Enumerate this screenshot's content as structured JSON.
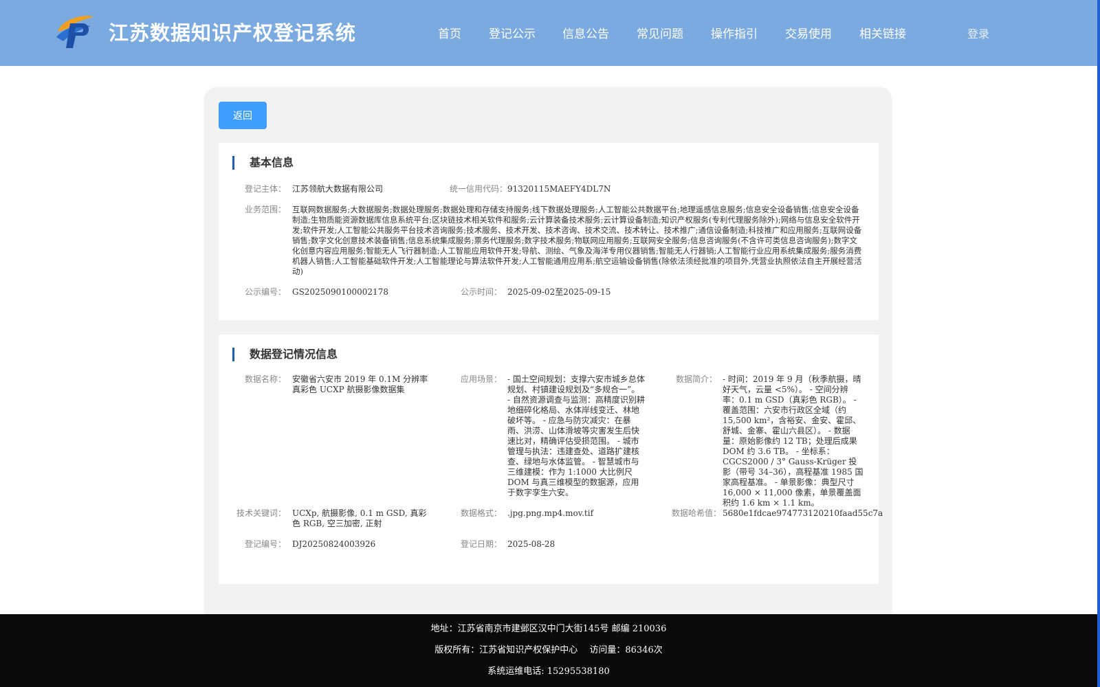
{
  "header": {
    "title": "江苏数据知识产权登记系统",
    "nav": [
      "首页",
      "登记公示",
      "信息公告",
      "常见问题",
      "操作指引",
      "交易使用",
      "相关链接"
    ],
    "login": "登录",
    "colors": {
      "header_bg": "#7aaae0",
      "accent": "#409eff",
      "title_bar": "#1e5fb4"
    }
  },
  "back_button": "返回",
  "basic_info": {
    "section_title": "基本信息",
    "subject_label": "登记主体：",
    "subject": "江苏领航大数据有限公司",
    "credit_label": "统一信用代码：",
    "credit": "91320115MAEFY4DL7N",
    "scope_label": "业务范围：",
    "scope": "互联网数据服务;大数据服务;数据处理服务;数据处理和存储支持服务;线下数据处理服务;人工智能公共数据平台;地理遥感信息服务;信息安全设备销售;信息安全设备制造;生物质能资源数据库信息系统平台;区块链技术相关软件和服务;云计算装备技术服务;云计算设备制造;知识产权服务(专利代理服务除外);网络与信息安全软件开发;软件开发;人工智能公共服务平台技术咨询服务;技术服务、技术开发、技术咨询、技术交流、技术转让、技术推广;通信设备制造;科技推广和应用服务;互联网设备销售;数字文化创意技术装备销售;信息系统集成服务;票务代理服务;数字技术服务;物联网应用服务;互联网安全服务;信息咨询服务(不含许可类信息咨询服务);数字文化创意内容应用服务;智能无人飞行器制造;人工智能应用软件开发;导航、测绘、气象及海洋专用仪器销售;智能无人行器销;人工智能行业应用系统集成服务;服务消费机器人销售;人工智能基础软件开发;人工智能理论与算法软件开发;人工智能通用应用系;航空运输设备销售(除依法须经批准的项目外,凭营业执照依法自主开展经营活动)",
    "pub_no_label": "公示编号：",
    "pub_no": "GS2025090100002178",
    "pub_time_label": "公示时间：",
    "pub_time": "2025-09-02至2025-09-15"
  },
  "registration_info": {
    "section_title": "数据登记情况信息",
    "name_label": "数据名称：",
    "name": "安徽省六安市 2019 年 0.1M 分辨率真彩色 UCXP 航摄影像数据集",
    "scene_label": "应用场景：",
    "scene": "- 国土空间规划：支撑六安市城乡总体规划、村镇建设规划及“多规合一”。 - 自然资源调查与监测：高精度识别耕地细碎化格局、水体岸线变迁、林地破坏等。 - 应急与防灾减灾：在暴雨、洪涝、山体滑坡等灾害发生后快速比对，精确评估受损范围。 - 城市管理与执法：违建查处、道路扩建核查、绿地与水体监管。 - 智慧城市与三维建模：作为 1:1000 大比例尺 DOM 与真三维模型的数据源，应用于数字孪生六安。",
    "intro_label": "数据简介：",
    "intro": "- 时间：2019 年 9 月（秋季航摄，晴好天气，云量 <5%）。 - 空间分辨率：0.1 m GSD（真彩色 RGB）。 - 覆盖范围：六安市行政区全域（约 15,500 km²，含裕安、金安、霍邱、舒城、金寨、霍山六县区）。 - 数据量：原始影像约 12 TB；处理后成果 DOM 约 3.6 TB。 - 坐标系：CGCS2000 / 3° Gauss-Krüger 投影（带号 34–36），高程基准 1985 国家高程基准。 - 单景影像：典型尺寸 16,000 × 11,000 像素，单景覆盖面积约 1.6 km × 1.1 km。",
    "keywords_label": "技术关键词：",
    "keywords": "UCXp, 航摄影像, 0.1 m GSD, 真彩色 RGB, 空三加密, 正射",
    "format_label": "数据格式：",
    "format": ".jpg.png.mp4.mov.tif",
    "hash_label": "数据哈希值：",
    "hash": "5680e1fdcae974773120210faad55c7a",
    "reg_no_label": "登记编号：",
    "reg_no": "DJ20250824003926",
    "reg_date_label": "登记日期：",
    "reg_date": "2025-08-28"
  },
  "footer": {
    "address": "地址：江苏省南京市建邺区汉中门大街145号 邮编 210036",
    "copyright": "版权所有：江苏省知识产权保护中心　 访问量：86346次",
    "phone": "系统运维电话: 15295538180"
  }
}
